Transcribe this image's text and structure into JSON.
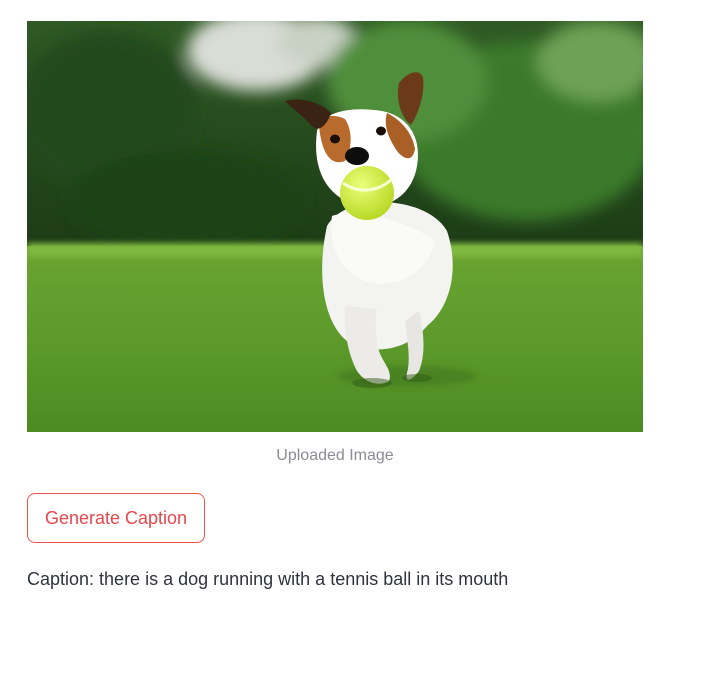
{
  "image": {
    "alt": "Jack Russell terrier running on grass with a tennis ball in its mouth",
    "caption": "Uploaded Image"
  },
  "actions": {
    "generate_label": "Generate Caption"
  },
  "result": {
    "caption_text": "Caption: there is a dog running with a tennis ball in its mouth"
  },
  "colors": {
    "accent": "#e5484d",
    "muted_text": "#8a8d97",
    "body_text": "#31333f"
  }
}
